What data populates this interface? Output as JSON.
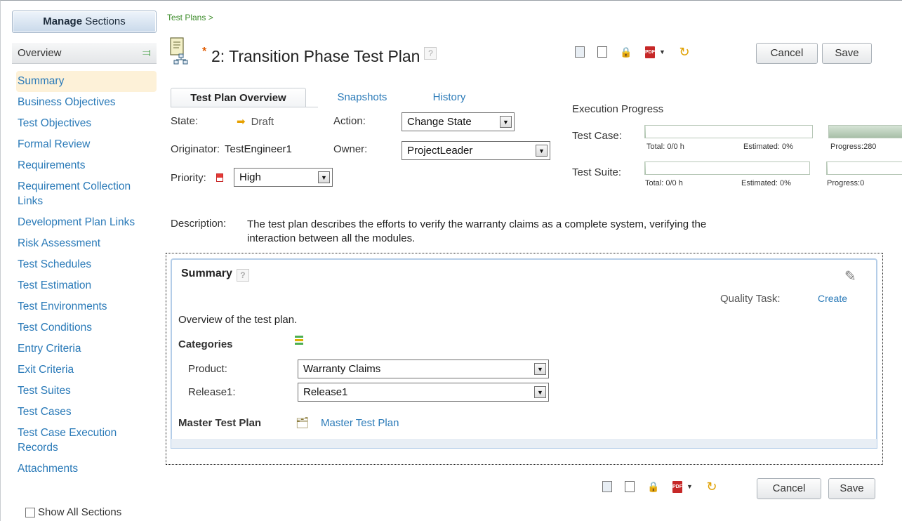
{
  "sidebar": {
    "manage_bold": "Manage",
    "manage_rest": " Sections",
    "header": "Overview",
    "items": [
      {
        "label": "Summary"
      },
      {
        "label": "Business Objectives"
      },
      {
        "label": "Test Objectives"
      },
      {
        "label": "Formal Review"
      },
      {
        "label": "Requirements"
      },
      {
        "label": "Requirement Collection Links"
      },
      {
        "label": "Development Plan Links"
      },
      {
        "label": "Risk Assessment"
      },
      {
        "label": "Test Schedules"
      },
      {
        "label": "Test Estimation"
      },
      {
        "label": "Test Environments"
      },
      {
        "label": "Test Conditions"
      },
      {
        "label": "Entry Criteria"
      },
      {
        "label": "Exit Criteria"
      },
      {
        "label": "Test Suites"
      },
      {
        "label": "Test Cases"
      },
      {
        "label": "Test Case Execution Records"
      },
      {
        "label": "Attachments"
      }
    ],
    "show_all": "Show All Sections"
  },
  "breadcrumb": "Test Plans >",
  "page": {
    "modified_mark": "*",
    "title": "2: Transition Phase Test Plan",
    "help": "?"
  },
  "toolbar": {
    "cancel": "Cancel",
    "save": "Save",
    "pdf_text": "PDF"
  },
  "tabs": [
    {
      "label": "Test Plan Overview"
    },
    {
      "label": "Snapshots"
    },
    {
      "label": "History"
    }
  ],
  "fields": {
    "state_label": "State:",
    "state_value": "Draft",
    "action_label": "Action:",
    "action_value": "Change State",
    "originator_label": "Originator:",
    "originator_value": "TestEngineer1",
    "owner_label": "Owner:",
    "owner_value": "ProjectLeader",
    "priority_label": "Priority:",
    "priority_value": "High"
  },
  "execution": {
    "title": "Execution Progress",
    "test_case": {
      "label": "Test Case:",
      "total": "Total: 0/0 h",
      "estimated": "Estimated: 0%",
      "progress": "Progress:280"
    },
    "test_suite": {
      "label": "Test Suite:",
      "total": "Total: 0/0 h",
      "estimated": "Estimated: 0%",
      "progress": "Progress:0"
    }
  },
  "description": {
    "label": "Description:",
    "text": "The test plan describes the efforts to verify the warranty claims as a complete system, verifying the interaction between all the modules."
  },
  "summary": {
    "title": "Summary",
    "quality_task_label": "Quality Task:",
    "quality_task_link": "Create",
    "overview": "Overview of the test plan.",
    "categories_label": "Categories",
    "product_label": "Product:",
    "product_value": "Warranty Claims",
    "release_label": "Release1:",
    "release_value": "Release1",
    "master_label": "Master Test Plan",
    "master_link": "Master Test Plan"
  }
}
